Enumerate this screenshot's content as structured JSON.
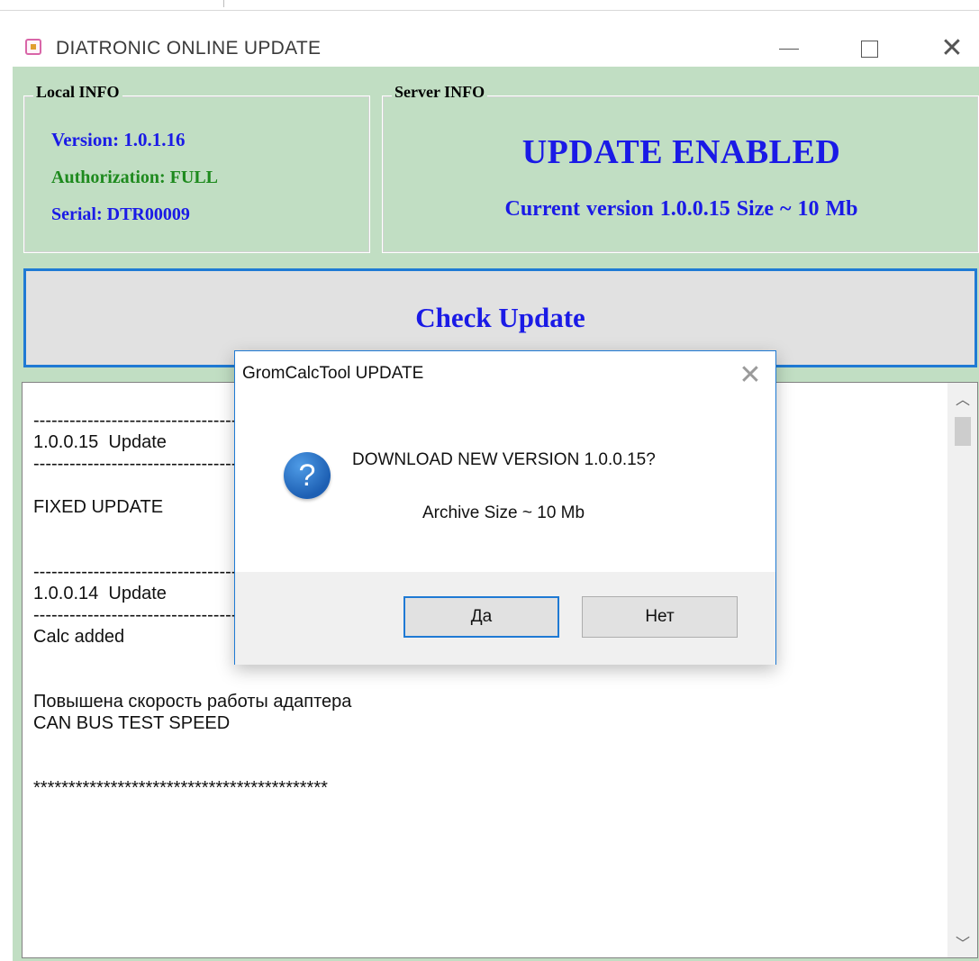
{
  "window": {
    "title": "DIATRONIC ONLINE UPDATE",
    "icon": "app-icon"
  },
  "local_info": {
    "title": "Local INFO",
    "version": "Version:  1.0.1.16",
    "authorization": "Authorization:  FULL",
    "serial": "Serial:  DTR00009"
  },
  "server_info": {
    "title": "Server INFO",
    "status": "UPDATE ENABLED",
    "current": "Current version 1.0.0.15   Size ~ 10 Mb"
  },
  "check_button": {
    "label": "Check Update"
  },
  "log": {
    "lines": [
      "------------------------------------------------------------",
      "1.0.0.15  Update",
      "------------------------------------------------------------",
      "",
      "FIXED UPDATE",
      "",
      "",
      "------------------------------------------------------------",
      "1.0.0.14  Update",
      "------------------------------------------------------------",
      "Calc added",
      "",
      "",
      "Повышена скорость работы адаптера",
      "CAN BUS TEST SPEED",
      "",
      "",
      "******************************************"
    ]
  },
  "dialog": {
    "title": "GromCalcTool UPDATE",
    "icon": "question-icon",
    "message": "DOWNLOAD NEW VERSION 1.0.0.15?",
    "detail": "Archive  Size ~ 10 Mb",
    "yes_label": "Да",
    "no_label": "Нет"
  },
  "colors": {
    "client_bg": "#c1dec3",
    "accent_blue": "#1a1ae6",
    "accent_green": "#1e8a1e",
    "focus_border": "#1f7ad4"
  }
}
